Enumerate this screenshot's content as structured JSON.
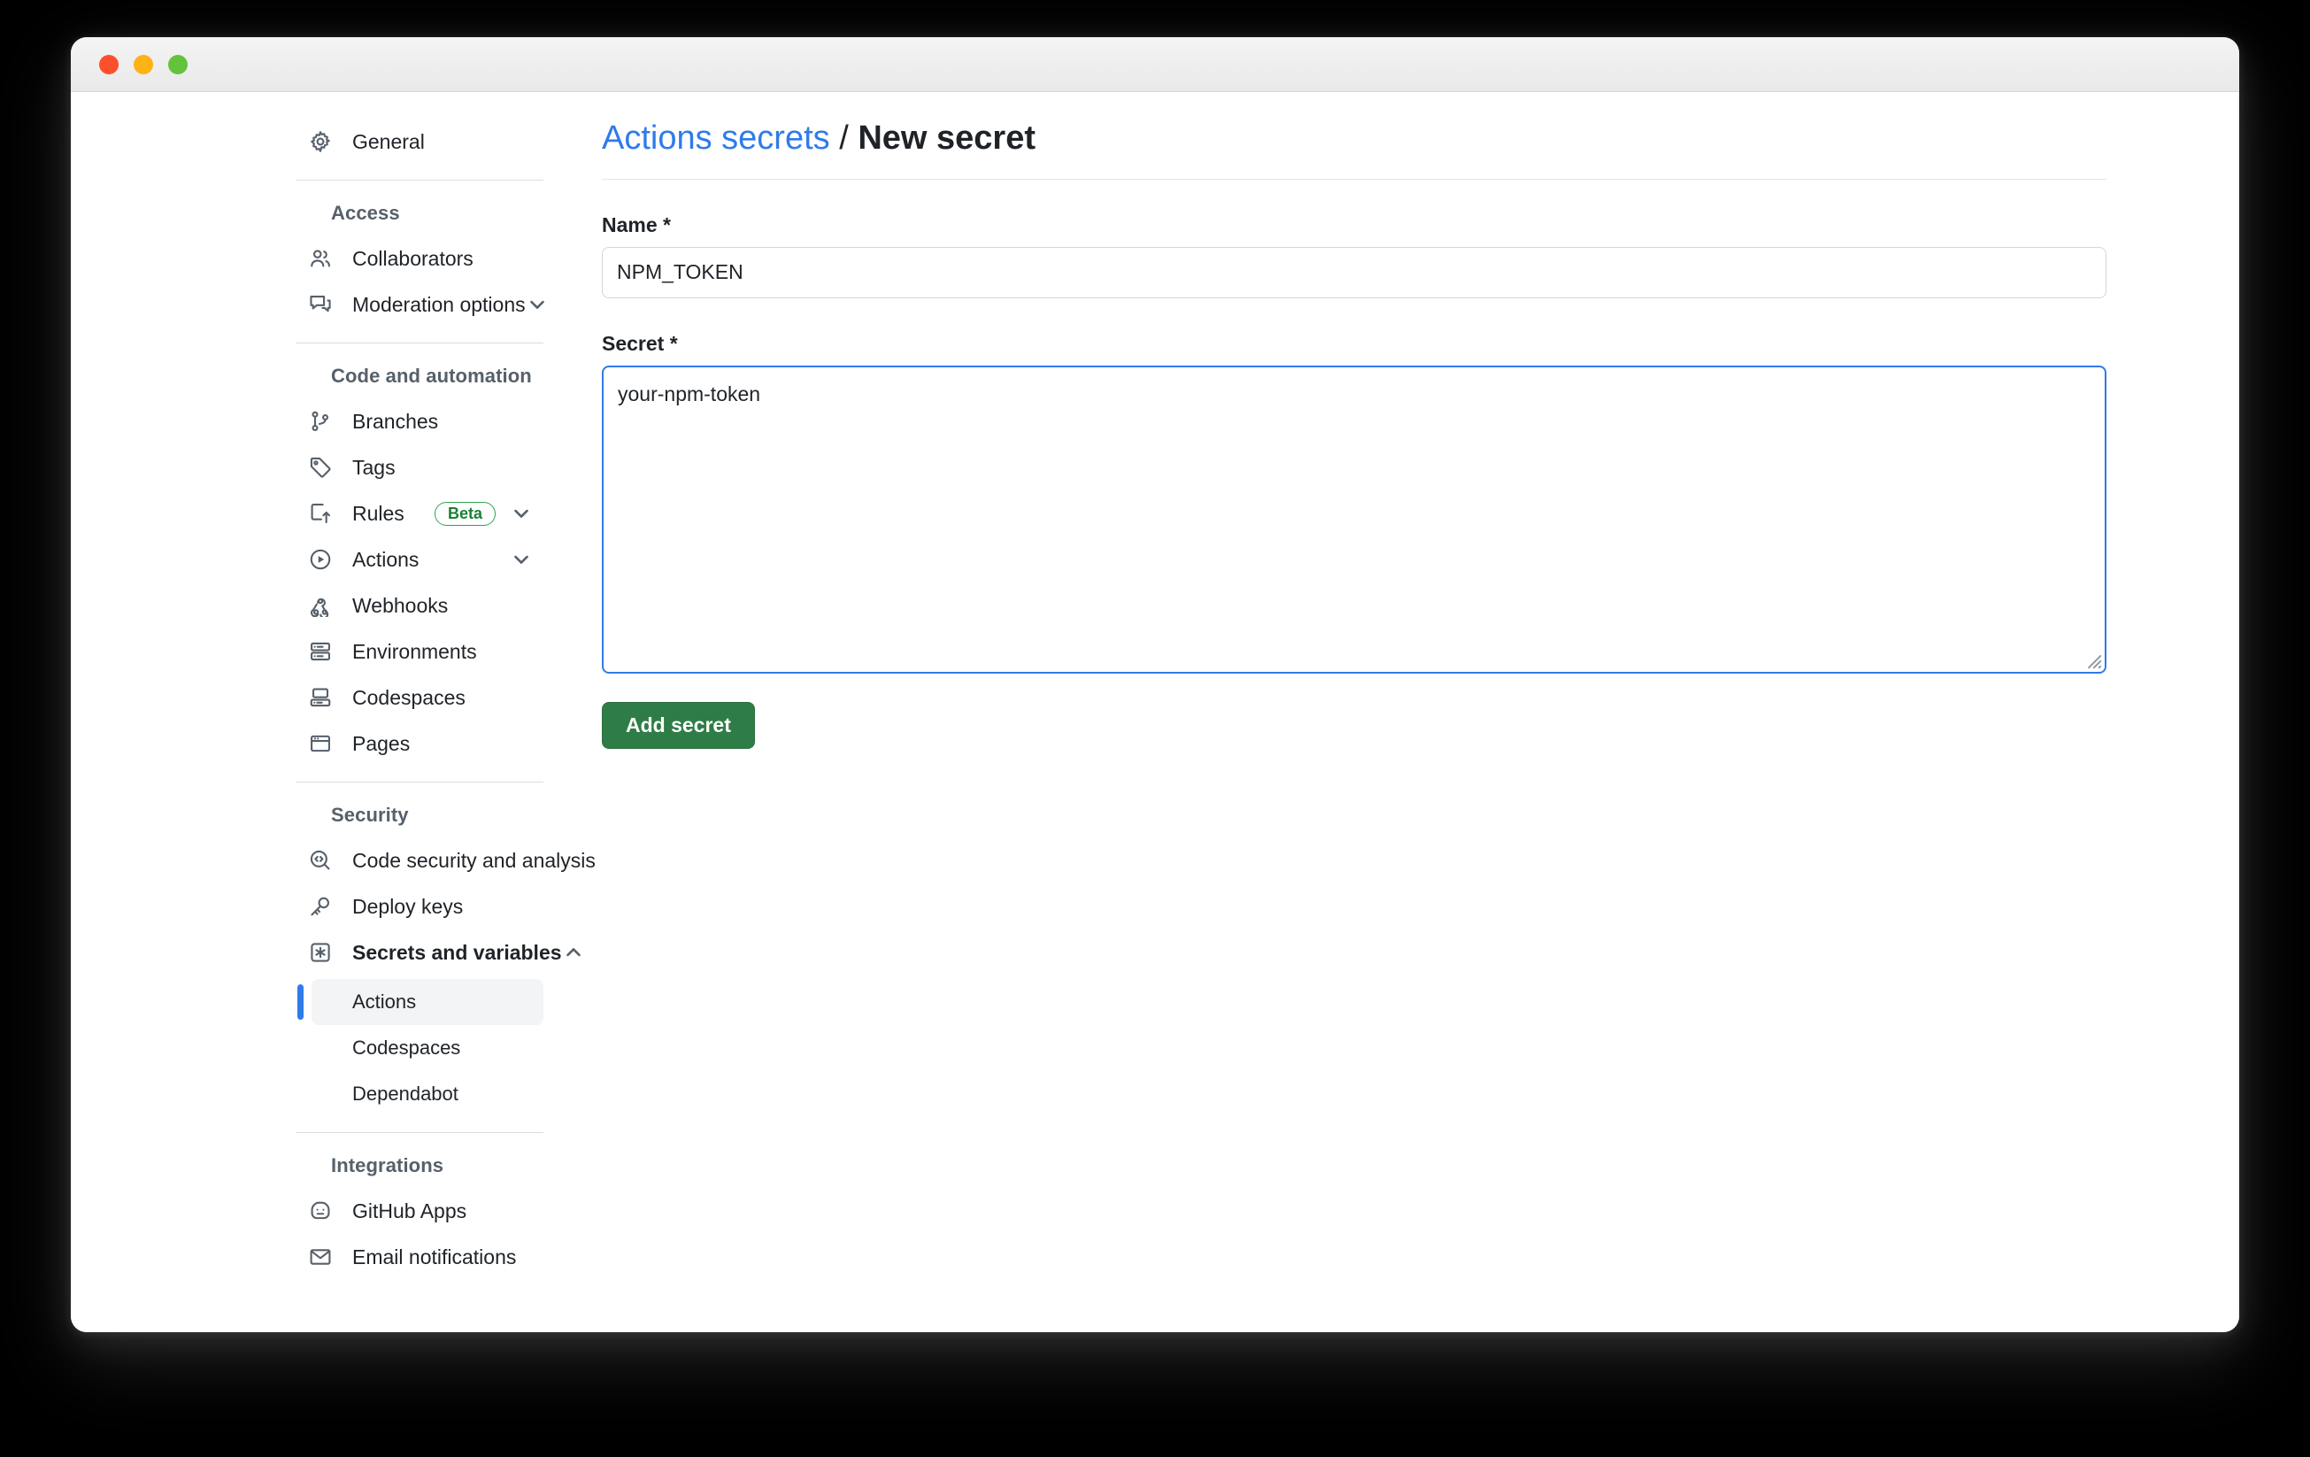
{
  "window": {
    "traffic_lights": [
      "close",
      "minimize",
      "zoom"
    ]
  },
  "sidebar": {
    "top_items": [
      {
        "label": "General",
        "icon": "gear-icon"
      }
    ],
    "sections": [
      {
        "title": "Access",
        "items": [
          {
            "label": "Collaborators",
            "icon": "people-icon",
            "chevron": null,
            "badge": null
          },
          {
            "label": "Moderation options",
            "icon": "comment-discussion-icon",
            "chevron": "down",
            "badge": null
          }
        ]
      },
      {
        "title": "Code and automation",
        "items": [
          {
            "label": "Branches",
            "icon": "git-branch-icon",
            "chevron": null,
            "badge": null
          },
          {
            "label": "Tags",
            "icon": "tag-icon",
            "chevron": null,
            "badge": null
          },
          {
            "label": "Rules",
            "icon": "rules-icon",
            "chevron": "down",
            "badge": "Beta"
          },
          {
            "label": "Actions",
            "icon": "play-circle-icon",
            "chevron": "down",
            "badge": null
          },
          {
            "label": "Webhooks",
            "icon": "webhook-icon",
            "chevron": null,
            "badge": null
          },
          {
            "label": "Environments",
            "icon": "server-icon",
            "chevron": null,
            "badge": null
          },
          {
            "label": "Codespaces",
            "icon": "codespaces-icon",
            "chevron": null,
            "badge": null
          },
          {
            "label": "Pages",
            "icon": "browser-icon",
            "chevron": null,
            "badge": null
          }
        ]
      },
      {
        "title": "Security",
        "items": [
          {
            "label": "Code security and analysis",
            "icon": "code-scan-icon",
            "chevron": null,
            "badge": null
          },
          {
            "label": "Deploy keys",
            "icon": "key-icon",
            "chevron": null,
            "badge": null
          },
          {
            "label": "Secrets and variables",
            "icon": "asterisk-box-icon",
            "chevron": "up",
            "badge": null,
            "bold": true
          }
        ],
        "subitems": [
          {
            "label": "Actions",
            "active": true
          },
          {
            "label": "Codespaces",
            "active": false
          },
          {
            "label": "Dependabot",
            "active": false
          }
        ]
      },
      {
        "title": "Integrations",
        "items": [
          {
            "label": "GitHub Apps",
            "icon": "github-apps-icon",
            "chevron": null,
            "badge": null
          },
          {
            "label": "Email notifications",
            "icon": "mail-icon",
            "chevron": null,
            "badge": null
          }
        ]
      }
    ]
  },
  "main": {
    "breadcrumb": {
      "parent": "Actions secrets",
      "separator": "/",
      "current": "New secret"
    },
    "name_field": {
      "label": "Name *",
      "value": "NPM_TOKEN",
      "placeholder": ""
    },
    "secret_field": {
      "label": "Secret *",
      "value": "your-npm-token",
      "placeholder": ""
    },
    "submit_button": "Add secret"
  },
  "colors": {
    "link": "#2f7bea",
    "primary_button": "#2f7d46",
    "beta_badge": "#1a7f37",
    "active_indicator": "#2f7bea"
  }
}
